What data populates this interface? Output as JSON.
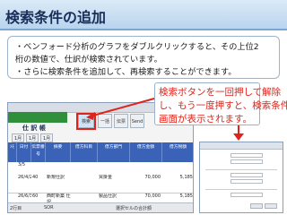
{
  "slide": {
    "title": "検索条件の追加",
    "info_lines": [
      "・ベンフォード分析のグラフをダブルクリックすると、その上位2",
      "桁の数値で、仕訳が検索されています。",
      "・さらに検索条件を追加して、再検索することができます。"
    ],
    "callout_lines": [
      "検索ボタンを一回押して解除",
      "し、もう一度押すと、検索条件",
      "画面が表示されます。"
    ],
    "accent_red": "#e0231a"
  },
  "screenshot": {
    "title": "仕 訳 帳",
    "toolbar": [
      "1月",
      "1月",
      "1月"
    ],
    "search_button": "検索",
    "buttons": [
      "一括",
      "伝票",
      "Send"
    ],
    "columns": [
      "ﾒﾓ",
      "日付",
      "伝票番号",
      "摘要",
      "借方科目",
      "借方部門",
      "借方金額",
      "借方税額"
    ],
    "rows": [
      [
        "",
        "3/5",
        "",
        "",
        "",
        "",
        "",
        ""
      ],
      [
        "",
        "26/4/25",
        "40",
        "新規仕訳",
        "",
        "買掛金",
        "70,000",
        "5,185"
      ],
      [
        "",
        "26/6/30",
        "60",
        "西町新築 仕訳",
        "",
        "製品仕訳",
        "70,000",
        "5,185"
      ]
    ],
    "status_left": "2行目",
    "status_mid": "SOR",
    "status_right": "選択セルの合計額"
  }
}
